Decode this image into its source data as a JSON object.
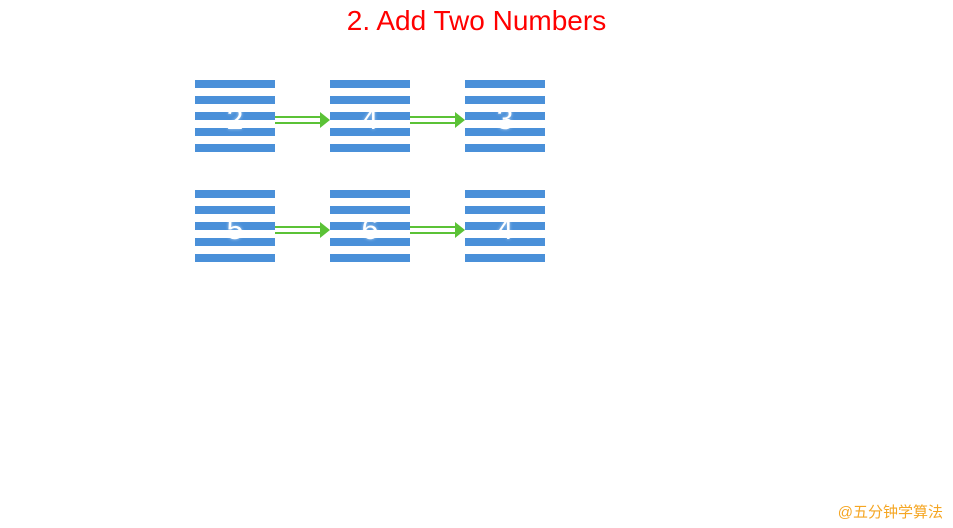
{
  "title": "2. Add Two Numbers",
  "lists": {
    "list1": {
      "node0": "2",
      "node1": "4",
      "node2": "3"
    },
    "list2": {
      "node0": "5",
      "node1": "6",
      "node2": "4"
    }
  },
  "watermark": "@五分钟学算法",
  "colors": {
    "title": "#ff0000",
    "node_stripe": "#4a90d9",
    "arrow": "#5bc236",
    "watermark": "#f5a623"
  }
}
